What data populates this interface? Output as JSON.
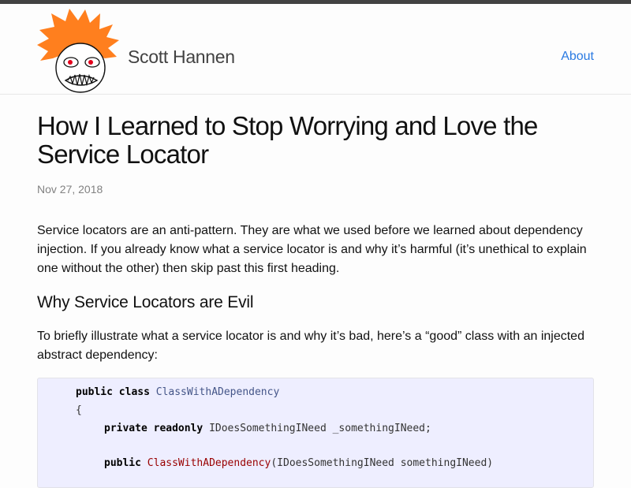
{
  "header": {
    "site_title": "Scott Hannen",
    "nav_about": "About"
  },
  "post": {
    "title": "How I Learned to Stop Worrying and Love the Service Locator",
    "date": "Nov 27, 2018",
    "intro": "Service locators are an anti-pattern. They are what we used before we learned about dependency injection. If you already know what a service locator is and why it’s harmful (it’s unethical to explain one without the other) then skip past this first heading.",
    "heading": "Why Service Locators are Evil",
    "para2": "To briefly illustrate what a service locator is and why it’s bad, here’s a “good” class with an injected abstract dependency:"
  },
  "code": {
    "l1_kw": "public class ",
    "l1_cls": "ClassWithADependency",
    "l2": "{",
    "l3_kw": "private readonly ",
    "l3_rest": "IDoesSomethingINeed _somethingINeed;",
    "l4_kw": "public ",
    "l4_fn": "ClassWithADependency",
    "l4_rest": "(IDoesSomethingINeed somethingINeed)"
  },
  "colors": {
    "link": "#2a7ae2",
    "logo_hair": "#ff7f1e",
    "logo_eye": "#e3001b",
    "code_bg": "#eeeeff"
  },
  "icons": [
    "spiky-hair-face-logo"
  ]
}
